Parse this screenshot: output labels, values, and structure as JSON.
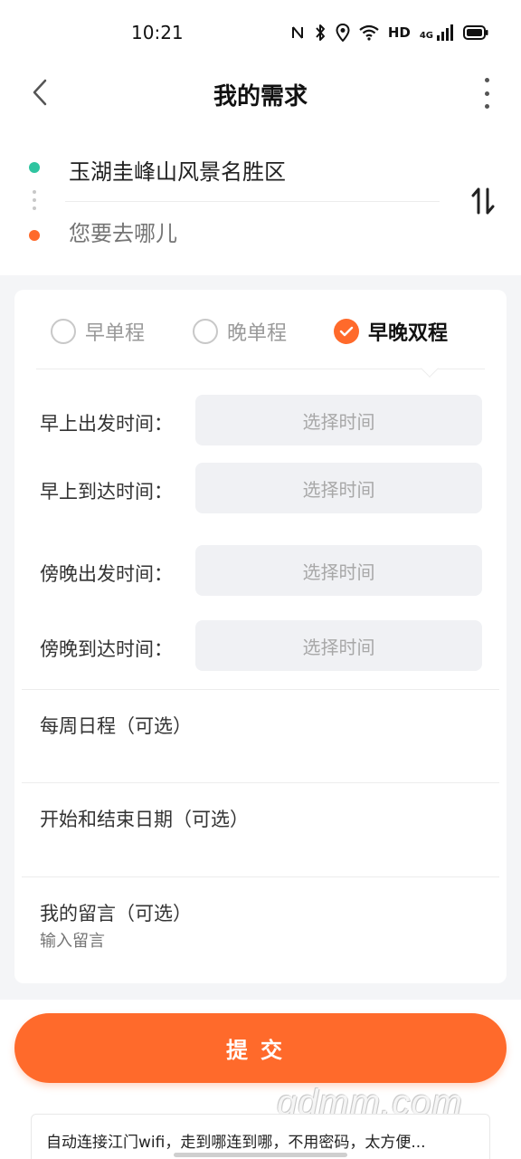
{
  "status_bar": {
    "time": "10:21",
    "hd": "HD",
    "network": "4G"
  },
  "header": {
    "title": "我的需求"
  },
  "route": {
    "start": "玉湖圭峰山风景名胜区",
    "end_placeholder": "您要去哪儿"
  },
  "trip_types": {
    "options": [
      "早单程",
      "晚单程",
      "早晚双程"
    ],
    "selected": "早晚双程"
  },
  "times": {
    "morning_depart_label": "早上出发时间：",
    "morning_arrive_label": "早上到达时间：",
    "evening_depart_label": "傍晚出发时间：",
    "evening_arrive_label": "傍晚到达时间：",
    "picker_placeholder": "选择时间"
  },
  "optional": {
    "weekly_schedule": "每周日程（可选）",
    "date_range": "开始和结束日期（可选）",
    "message_label": "我的留言（可选）",
    "message_placeholder": "输入留言"
  },
  "submit_label": "提交",
  "ad": {
    "text": "自动连接江门wifi，走到哪连到哪，不用密码，太方便..."
  },
  "watermark": "gdmm.com",
  "colors": {
    "accent": "#ff6a2b",
    "start_dot": "#2fc4a0",
    "background_gray": "#f4f5f7"
  }
}
